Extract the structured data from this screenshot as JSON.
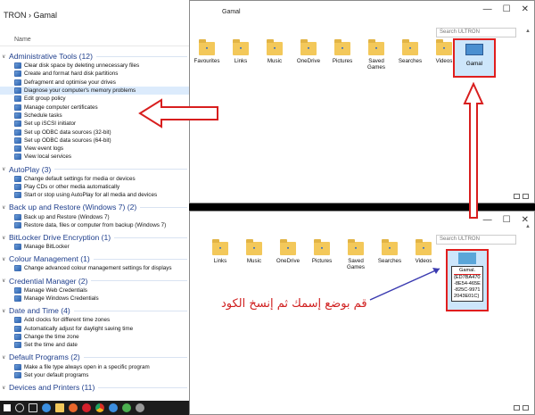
{
  "left_panel": {
    "breadcrumb": "TRON  ›  Gamal",
    "column_header": "Name",
    "groups": [
      {
        "title": "Administrative Tools (12)",
        "items": [
          "Clear disk space by deleting unnecessary files",
          "Create and format hard disk partitions",
          "Defragment and optimise your drives",
          "Diagnose your computer's memory problems",
          "Edit group policy",
          "Manage computer certificates",
          "Schedule tasks",
          "Set up iSCSI initiator",
          "Set up ODBC data sources (32-bit)",
          "Set up ODBC data sources (64-bit)",
          "View event logs",
          "View local services"
        ]
      },
      {
        "title": "AutoPlay (3)",
        "items": [
          "Change default settings for media or devices",
          "Play CDs or other media automatically",
          "Start or stop using AutoPlay for all media and devices"
        ]
      },
      {
        "title": "Back up and Restore (Windows 7) (2)",
        "items": [
          "Back up and Restore (Windows 7)",
          "Restore data, files or computer from backup (Windows 7)"
        ]
      },
      {
        "title": "BitLocker Drive Encryption (1)",
        "items": [
          "Manage BitLocker"
        ]
      },
      {
        "title": "Colour Management (1)",
        "items": [
          "Change advanced colour management settings for displays"
        ]
      },
      {
        "title": "Credential Manager (2)",
        "items": [
          "Manage Web Credentials",
          "Manage Windows Credentials"
        ]
      },
      {
        "title": "Date and Time (4)",
        "items": [
          "Add clocks for different time zones",
          "Automatically adjust for daylight saving time",
          "Change the time zone",
          "Set the time and date"
        ]
      },
      {
        "title": "Default Programs (2)",
        "items": [
          "Make a file type always open in a specific program",
          "Set your default programs"
        ]
      },
      {
        "title": "Devices and Printers (11)",
        "items": []
      }
    ]
  },
  "window_top": {
    "title": "Gamal",
    "search_placeholder": "Search ULTRON",
    "folders": [
      "Favourites",
      "Links",
      "Music",
      "OneDrive",
      "Pictures",
      "Saved Games",
      "Searches",
      "Videos"
    ],
    "new_folder": "Gamal",
    "controls": {
      "minimize": "—",
      "maximize": "☐",
      "close": "✕"
    }
  },
  "window_bottom": {
    "search_placeholder": "Search ULTRON",
    "folders": [
      "Links",
      "Music",
      "OneDrive",
      "Pictures",
      "Saved Games",
      "Searches",
      "Videos"
    ],
    "rename_text_line1": "Gamal.",
    "rename_text_rest": "{ED7BA470-8E54-465E-825C-99712043E01C}",
    "controls": {
      "minimize": "—",
      "maximize": "☐",
      "close": "✕"
    }
  },
  "caption": "قم بوضع إسمك ثم إنسخ الكود",
  "colors": {
    "arrow": "#d81e1e",
    "accent": "#1e3e8c"
  }
}
